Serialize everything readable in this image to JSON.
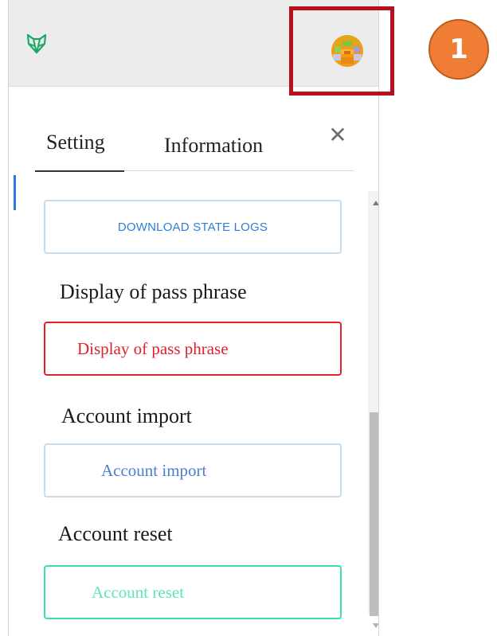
{
  "tabs": [
    {
      "label": "Setting"
    },
    {
      "label": "Information"
    }
  ],
  "close_label": "✕",
  "step_badge": "1",
  "actions": {
    "download_state_logs": "DOWNLOAD STATE LOGS",
    "passphrase_heading": "Display of pass phrase",
    "passphrase_button": "Display of pass phrase",
    "import_heading": "Account import",
    "import_button": "Account import",
    "reset_heading": "Account reset",
    "reset_button": "Account reset"
  },
  "colors": {
    "brand_green": "#1aa866",
    "highlight_red": "#b5121b",
    "badge_orange": "#ef7d36",
    "danger_red": "#e8202a",
    "link_blue": "#2b7fd6",
    "reset_teal": "#33e2b4"
  },
  "icons": {
    "logo": "fox-head-icon",
    "avatar": "identicon-avatar",
    "close": "close-icon"
  }
}
